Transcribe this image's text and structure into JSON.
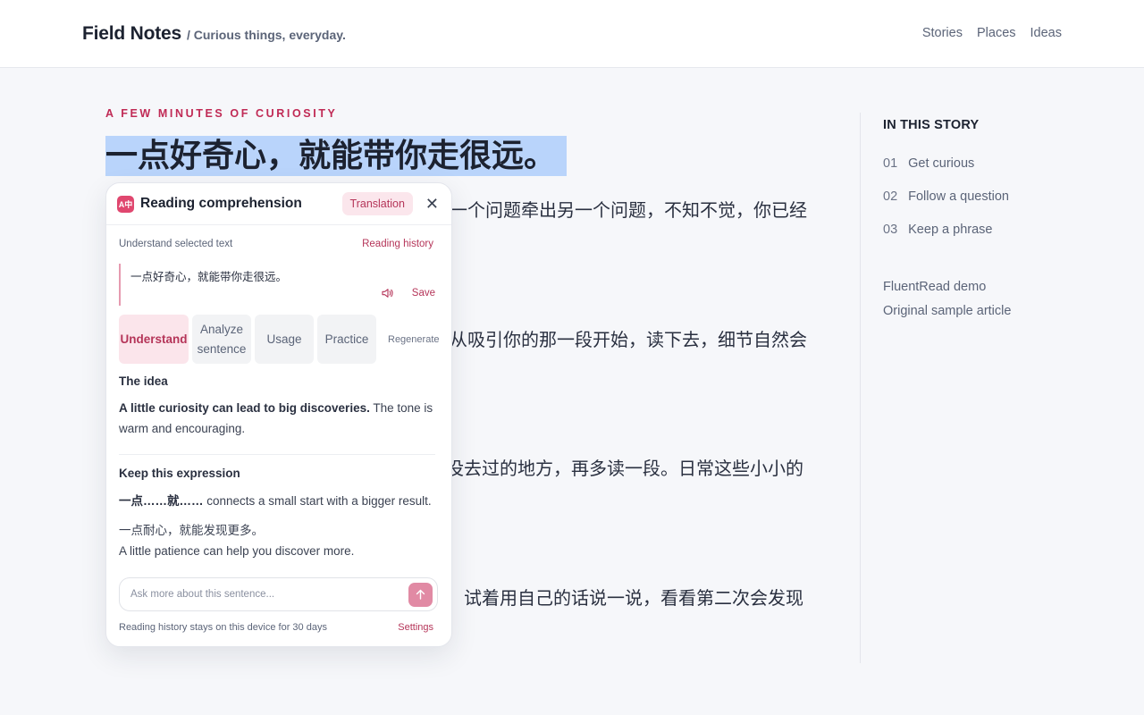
{
  "header": {
    "brand": "Field Notes",
    "tagline": "/ Curious things, everyday.",
    "nav": [
      "Stories",
      "Places",
      "Ideas"
    ]
  },
  "article": {
    "kicker": "A FEW MINUTES OF CURIOSITY",
    "headline": "一点好奇心，就能带你走很远。",
    "paragraph_fragments": [
      "一个问题牵出另一个问题，不知不觉，你已经",
      "从吸引你的那一段开始，读下去，细节自然会",
      "没去过的地方，再多读一段。日常这些小小的",
      "试着用自己的话说一说，看看第二次会发现"
    ]
  },
  "sidebar": {
    "title": "IN THIS STORY",
    "items": [
      {
        "num": "01",
        "label": "Get curious"
      },
      {
        "num": "02",
        "label": "Follow a question"
      },
      {
        "num": "03",
        "label": "Keep a phrase"
      }
    ],
    "links": [
      "FluentRead demo",
      "Original sample article"
    ]
  },
  "panel": {
    "icon_text": "A中",
    "title": "Reading comprehension",
    "translation_btn": "Translation",
    "close": "✕",
    "subheader_left": "Understand selected text",
    "subheader_right": "Reading history",
    "quote": "一点好奇心，就能带你走很远。",
    "save": "Save",
    "tabs": [
      "Understand",
      "Analyze sentence",
      "Usage",
      "Practice"
    ],
    "regenerate": "Regenerate",
    "idea_title": "The idea",
    "idea_bold": "A little curiosity can lead to big discoveries.",
    "idea_rest": " The tone is warm and encouraging.",
    "expr_title": "Keep this expression",
    "expr_bold": "一点……就……",
    "expr_rest": " connects a small start with a bigger result.",
    "example_zh": "一点耐心，就能发现更多。",
    "example_en": "A little patience can help you discover more.",
    "ask_placeholder": "Ask more about this sentence...",
    "footer_left": "Reading history stays on this device for 30 days",
    "footer_right": "Settings",
    "accent": "#c02a55"
  }
}
